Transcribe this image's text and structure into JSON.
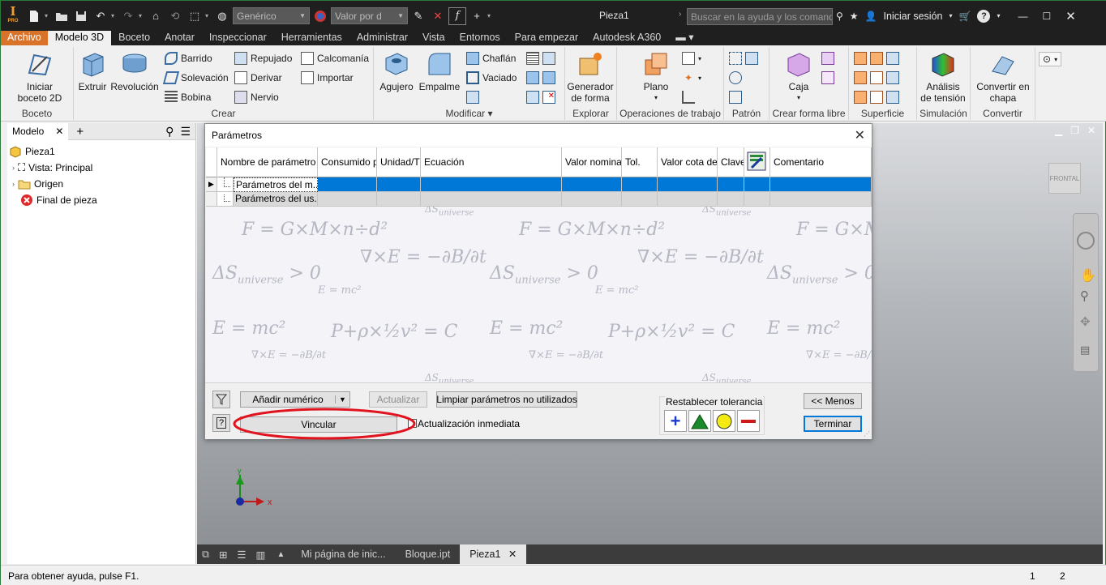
{
  "titlebar": {
    "app_logo": "I",
    "app_logo_sub": "PRO",
    "material_combo": "Genérico",
    "appearance_combo": "Valor por d",
    "document_title": "Pieza1",
    "search_placeholder": "Buscar en la ayuda y los comandos",
    "sign_in": "Iniciar sesión"
  },
  "menu": {
    "items": [
      "Archivo",
      "Modelo 3D",
      "Boceto",
      "Anotar",
      "Inspeccionar",
      "Herramientas",
      "Administrar",
      "Vista",
      "Entornos",
      "Para empezar",
      "Autodesk A360"
    ],
    "active": "Modelo 3D"
  },
  "ribbon": {
    "boceto": {
      "label": "Boceto",
      "start_sketch": "Iniciar",
      "start_sketch_2": "boceto 2D"
    },
    "crear": {
      "label": "Crear",
      "extrude": "Extruir",
      "revolve": "Revolución",
      "sweep": "Barrido",
      "loft": "Solevación",
      "coil": "Bobina",
      "emboss": "Repujado",
      "derive": "Derivar",
      "rib": "Nervio",
      "decal": "Calcomanía",
      "import": "Importar"
    },
    "modificar": {
      "label": "Modificar",
      "hole": "Agujero",
      "fillet": "Empalme",
      "chamfer": "Chaflán",
      "shell": "Vaciado"
    },
    "explorar": {
      "label": "Explorar",
      "shape_gen": "Generador",
      "shape_gen_2": "de forma"
    },
    "operaciones": {
      "label": "Operaciones de trabajo",
      "plane": "Plano"
    },
    "patron": {
      "label": "Patrón"
    },
    "forma_libre": {
      "label": "Crear forma libre",
      "box": "Caja"
    },
    "superficie": {
      "label": "Superficie"
    },
    "simulacion": {
      "label": "Simulación",
      "stress": "Análisis",
      "stress_2": "de tensión"
    },
    "convertir": {
      "label": "Convertir",
      "sheet": "Convertir en",
      "sheet_2": "chapa"
    }
  },
  "browser": {
    "tab_label": "Modelo",
    "tree": [
      {
        "label": "Pieza1"
      },
      {
        "label": "Vista: Principal"
      },
      {
        "label": "Origen"
      },
      {
        "label": "Final de pieza"
      }
    ]
  },
  "viewcube_label": "FRONTAL",
  "dialog": {
    "title": "Parámetros",
    "columns": [
      "Nombre de parámetro",
      "Consumido po",
      "Unidad/Tip",
      "Ecuación",
      "Valor nominal",
      "Tol.",
      "Valor cota del",
      "Clave",
      "",
      "Comentario"
    ],
    "rows": [
      "Parámetros del m...",
      "Parámetros del us..."
    ],
    "add_numeric": "Añadir numérico",
    "update": "Actualizar",
    "purge": "Limpiar parámetros no utilizados",
    "link": "Vincular",
    "immediate_update": "Actualización inmediata",
    "reset_tolerance": "Restablecer tolerancia",
    "less": "<< Menos",
    "done": "Terminar"
  },
  "doctabs": {
    "items": [
      "Mi página de inic...",
      "Bloque.ipt",
      "Pieza1"
    ],
    "active": "Pieza1"
  },
  "status": {
    "help": "Para obtener ayuda, pulse F1.",
    "count1": "1",
    "count2": "2"
  },
  "colors": {
    "accent_orange": "#d9732a",
    "selection_blue": "#0078d7",
    "titlebar": "#1f1f1f",
    "annotation_red": "#e0141e"
  }
}
